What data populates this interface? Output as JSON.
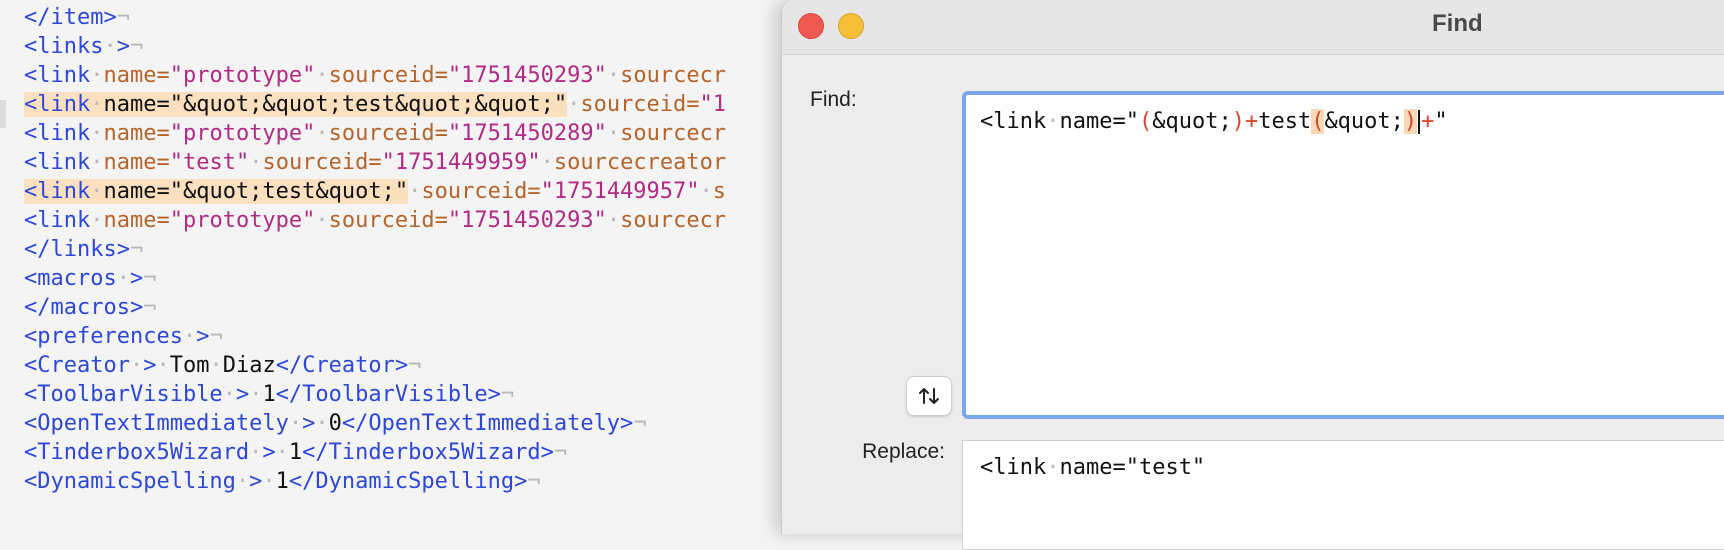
{
  "editor": {
    "lines": [
      [
        {
          "t": "</item>",
          "c": "c-tag"
        },
        {
          "t": "¬",
          "c": "c-eol"
        }
      ],
      [
        {
          "t": "<links",
          "c": "c-tag"
        },
        {
          "t": "·",
          "c": "c-dot"
        },
        {
          "t": ">",
          "c": "c-tag"
        },
        {
          "t": "¬",
          "c": "c-eol"
        }
      ],
      [
        {
          "t": "<link",
          "c": "c-tag"
        },
        {
          "t": "·",
          "c": "c-dot"
        },
        {
          "t": "name=",
          "c": "c-attr"
        },
        {
          "t": "\"prototype\"",
          "c": "c-val"
        },
        {
          "t": "·",
          "c": "c-dot"
        },
        {
          "t": "sourceid=",
          "c": "c-attr"
        },
        {
          "t": "\"1751450293\"",
          "c": "c-val"
        },
        {
          "t": "·",
          "c": "c-dot"
        },
        {
          "t": "sourcecr",
          "c": "c-attr"
        }
      ],
      [
        {
          "t": "<link",
          "c": "c-tag",
          "h": true
        },
        {
          "t": "·",
          "c": "c-dot",
          "h": true
        },
        {
          "t": "name=\"&quot;&quot;test&quot;&quot;\"",
          "c": "c-text",
          "h": true
        },
        {
          "t": "·",
          "c": "c-dot"
        },
        {
          "t": "sourceid=",
          "c": "c-attr"
        },
        {
          "t": "\"1",
          "c": "c-val"
        }
      ],
      [
        {
          "t": "<link",
          "c": "c-tag"
        },
        {
          "t": "·",
          "c": "c-dot"
        },
        {
          "t": "name=",
          "c": "c-attr"
        },
        {
          "t": "\"prototype\"",
          "c": "c-val"
        },
        {
          "t": "·",
          "c": "c-dot"
        },
        {
          "t": "sourceid=",
          "c": "c-attr"
        },
        {
          "t": "\"1751450289\"",
          "c": "c-val"
        },
        {
          "t": "·",
          "c": "c-dot"
        },
        {
          "t": "sourcecr",
          "c": "c-attr"
        }
      ],
      [
        {
          "t": "<link",
          "c": "c-tag"
        },
        {
          "t": "·",
          "c": "c-dot"
        },
        {
          "t": "name=",
          "c": "c-attr"
        },
        {
          "t": "\"test\"",
          "c": "c-val"
        },
        {
          "t": "·",
          "c": "c-dot"
        },
        {
          "t": "sourceid=",
          "c": "c-attr"
        },
        {
          "t": "\"1751449959\"",
          "c": "c-val"
        },
        {
          "t": "·",
          "c": "c-dot"
        },
        {
          "t": "sourcecreator",
          "c": "c-attr"
        }
      ],
      [
        {
          "t": "<link",
          "c": "c-tag",
          "h": true
        },
        {
          "t": "·",
          "c": "c-dot",
          "h": true
        },
        {
          "t": "name=\"&quot;test&quot;\"",
          "c": "c-text",
          "h": true
        },
        {
          "t": "·",
          "c": "c-dot"
        },
        {
          "t": "sourceid=",
          "c": "c-attr"
        },
        {
          "t": "\"1751449957\"",
          "c": "c-val"
        },
        {
          "t": "·",
          "c": "c-dot"
        },
        {
          "t": "s",
          "c": "c-attr"
        }
      ],
      [
        {
          "t": "<link",
          "c": "c-tag"
        },
        {
          "t": "·",
          "c": "c-dot"
        },
        {
          "t": "name=",
          "c": "c-attr"
        },
        {
          "t": "\"prototype\"",
          "c": "c-val"
        },
        {
          "t": "·",
          "c": "c-dot"
        },
        {
          "t": "sourceid=",
          "c": "c-attr"
        },
        {
          "t": "\"1751450293\"",
          "c": "c-val"
        },
        {
          "t": "·",
          "c": "c-dot"
        },
        {
          "t": "sourcecr",
          "c": "c-attr"
        }
      ],
      [
        {
          "t": "</links>",
          "c": "c-tag"
        },
        {
          "t": "¬",
          "c": "c-eol"
        }
      ],
      [
        {
          "t": "<macros",
          "c": "c-tag"
        },
        {
          "t": "·",
          "c": "c-dot"
        },
        {
          "t": ">",
          "c": "c-tag"
        },
        {
          "t": "¬",
          "c": "c-eol"
        }
      ],
      [
        {
          "t": "</macros>",
          "c": "c-tag"
        },
        {
          "t": "¬",
          "c": "c-eol"
        }
      ],
      [
        {
          "t": "<preferences",
          "c": "c-tag"
        },
        {
          "t": "·",
          "c": "c-dot"
        },
        {
          "t": ">",
          "c": "c-tag"
        },
        {
          "t": "¬",
          "c": "c-eol"
        }
      ],
      [
        {
          "t": "<Creator",
          "c": "c-tag"
        },
        {
          "t": "·",
          "c": "c-dot"
        },
        {
          "t": ">",
          "c": "c-tag"
        },
        {
          "t": "·",
          "c": "c-dot"
        },
        {
          "t": "Tom",
          "c": "c-text"
        },
        {
          "t": "·",
          "c": "c-dot"
        },
        {
          "t": "Diaz",
          "c": "c-text"
        },
        {
          "t": "</Creator>",
          "c": "c-tag"
        },
        {
          "t": "¬",
          "c": "c-eol"
        }
      ],
      [
        {
          "t": "<ToolbarVisible",
          "c": "c-tag"
        },
        {
          "t": "·",
          "c": "c-dot"
        },
        {
          "t": ">",
          "c": "c-tag"
        },
        {
          "t": "·",
          "c": "c-dot"
        },
        {
          "t": "1",
          "c": "c-text"
        },
        {
          "t": "</ToolbarVisible>",
          "c": "c-tag"
        },
        {
          "t": "¬",
          "c": "c-eol"
        }
      ],
      [
        {
          "t": "<OpenTextImmediately",
          "c": "c-tag"
        },
        {
          "t": "·",
          "c": "c-dot"
        },
        {
          "t": ">",
          "c": "c-tag"
        },
        {
          "t": "·",
          "c": "c-dot"
        },
        {
          "t": "0",
          "c": "c-text"
        },
        {
          "t": "</OpenTextImmediately>",
          "c": "c-tag"
        },
        {
          "t": "¬",
          "c": "c-eol"
        }
      ],
      [
        {
          "t": "<Tinderbox5Wizard",
          "c": "c-tag"
        },
        {
          "t": "·",
          "c": "c-dot"
        },
        {
          "t": ">",
          "c": "c-tag"
        },
        {
          "t": "·",
          "c": "c-dot"
        },
        {
          "t": "1",
          "c": "c-text"
        },
        {
          "t": "</Tinderbox5Wizard>",
          "c": "c-tag"
        },
        {
          "t": "¬",
          "c": "c-eol"
        }
      ],
      [
        {
          "t": "<DynamicSpelling",
          "c": "c-tag"
        },
        {
          "t": "·",
          "c": "c-dot"
        },
        {
          "t": ">",
          "c": "c-tag"
        },
        {
          "t": "·",
          "c": "c-dot"
        },
        {
          "t": "1",
          "c": "c-text"
        },
        {
          "t": "</DynamicSpelling>",
          "c": "c-tag"
        },
        {
          "t": "¬",
          "c": "c-eol"
        }
      ]
    ]
  },
  "find_panel": {
    "title": "Find",
    "find_label": "Find:",
    "replace_label": "Replace:",
    "find_segments": [
      {
        "t": "<link",
        "c": ""
      },
      {
        "t": "·",
        "c": "c-dot"
      },
      {
        "t": "name=\"",
        "c": ""
      },
      {
        "t": "(",
        "c": "rx"
      },
      {
        "t": "&quot;",
        "c": ""
      },
      {
        "t": ")",
        "c": "rx"
      },
      {
        "t": "+",
        "c": "rx"
      },
      {
        "t": "test",
        "c": ""
      },
      {
        "t": "(",
        "c": "grp"
      },
      {
        "t": "&quot;",
        "c": ""
      },
      {
        "t": ")",
        "c": "grp"
      },
      {
        "t": "CARET",
        "c": "caret"
      },
      {
        "t": "+",
        "c": "rx"
      },
      {
        "t": "\"",
        "c": ""
      }
    ],
    "replace_segments": [
      {
        "t": "<link",
        "c": ""
      },
      {
        "t": "·",
        "c": "c-dot"
      },
      {
        "t": "name=\"test\"",
        "c": ""
      }
    ],
    "swap_icon": "swap-arrows-icon",
    "colors": {
      "tag": "#2d47d6",
      "attribute": "#b5652c",
      "value": "#b02a86",
      "highlight": "#fbe0c0",
      "focus_ring": "#7aa7ea",
      "close": "#ee5a52",
      "minimize": "#f5be36"
    }
  }
}
